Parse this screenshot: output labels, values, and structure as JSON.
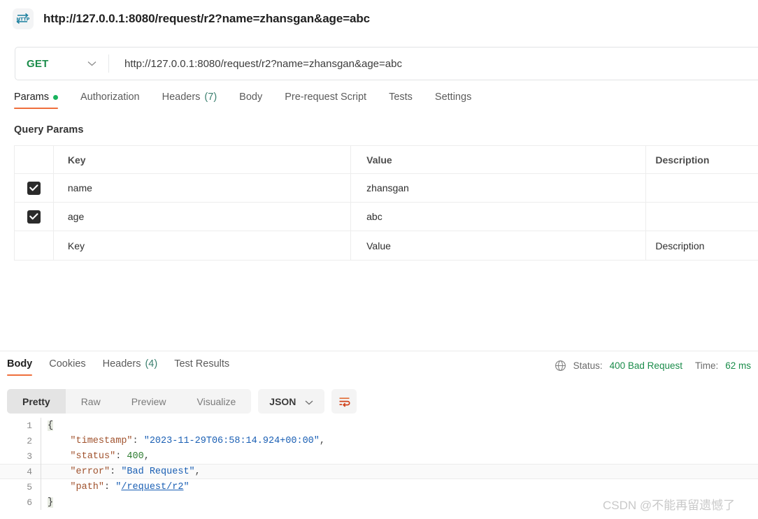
{
  "window": {
    "title": "http://127.0.0.1:8080/request/r2?name=zhansgan&age=abc",
    "icon": "http-protocol-icon"
  },
  "request": {
    "method": "GET",
    "method_chevron": "chevron-down-icon",
    "url": "http://127.0.0.1:8080/request/r2?name=zhansgan&age=abc",
    "tabs": [
      {
        "label": "Params",
        "count": "",
        "badge": "dot",
        "active": true
      },
      {
        "label": "Authorization",
        "count": "",
        "badge": "",
        "active": false
      },
      {
        "label": "Headers",
        "count": "(7)",
        "badge": "",
        "active": false
      },
      {
        "label": "Body",
        "count": "",
        "badge": "",
        "active": false
      },
      {
        "label": "Pre-request Script",
        "count": "",
        "badge": "",
        "active": false
      },
      {
        "label": "Tests",
        "count": "",
        "badge": "",
        "active": false
      },
      {
        "label": "Settings",
        "count": "",
        "badge": "",
        "active": false
      }
    ],
    "section_label": "Query Params",
    "table": {
      "headers": {
        "key": "Key",
        "value": "Value",
        "description": "Description"
      },
      "rows": [
        {
          "checked": true,
          "key": "name",
          "value": "zhansgan",
          "description": ""
        },
        {
          "checked": true,
          "key": "age",
          "value": "abc",
          "description": ""
        }
      ],
      "placeholder_row": {
        "key": "Key",
        "value": "Value",
        "description": "Description"
      }
    }
  },
  "response": {
    "tabs": [
      {
        "label": "Body",
        "count": "",
        "active": true
      },
      {
        "label": "Cookies",
        "count": "",
        "active": false
      },
      {
        "label": "Headers",
        "count": "(4)",
        "active": false
      },
      {
        "label": "Test Results",
        "count": "",
        "active": false
      }
    ],
    "status": {
      "globe_icon": "globe-icon",
      "status_label": "Status:",
      "status_value": "400 Bad Request",
      "time_label": "Time:",
      "time_value": "62 ms"
    },
    "view_modes": [
      {
        "label": "Pretty",
        "active": true
      },
      {
        "label": "Raw",
        "active": false
      },
      {
        "label": "Preview",
        "active": false
      },
      {
        "label": "Visualize",
        "active": false
      }
    ],
    "format": {
      "label": "JSON",
      "chevron": "chevron-down-icon"
    },
    "wrap_button": "word-wrap-icon",
    "body_lines": [
      {
        "n": "1",
        "text": "{"
      },
      {
        "n": "2",
        "text": "    \"timestamp\": \"2023-11-29T06:58:14.924+00:00\","
      },
      {
        "n": "3",
        "text": "    \"status\": 400,"
      },
      {
        "n": "4",
        "text": "    \"error\": \"Bad Request\","
      },
      {
        "n": "5",
        "text": "    \"path\": \"/request/r2\""
      },
      {
        "n": "6",
        "text": "}"
      }
    ],
    "body_json": {
      "timestamp": "2023-11-29T06:58:14.924+00:00",
      "status": 400,
      "error": "Bad Request",
      "path": "/request/r2"
    }
  },
  "watermark": {
    "text": "CSDN @不能再留遗憾了"
  },
  "colors": {
    "accent_orange": "#ef6f3c",
    "method_green": "#1a8c4a",
    "status_green": "#1a8c4a",
    "badge_green": "#19b35d",
    "json_key": "#a0522d",
    "json_string": "#1a5fb4",
    "json_number": "#2f7d32"
  }
}
